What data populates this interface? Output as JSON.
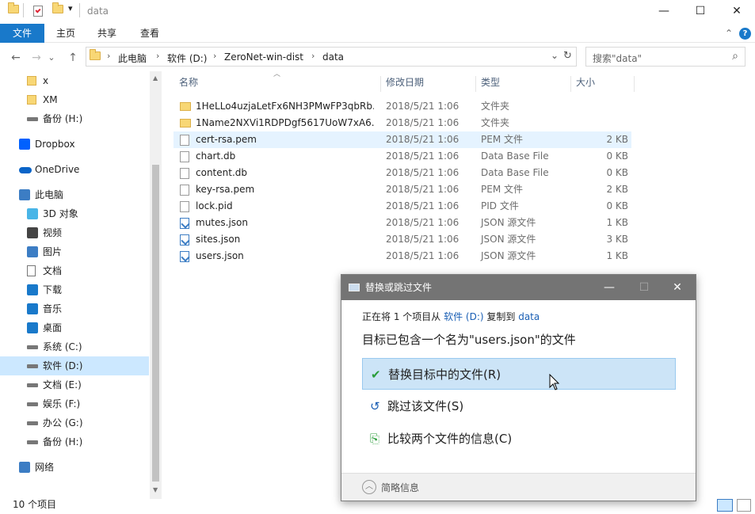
{
  "window": {
    "title": "data",
    "minimize": "—",
    "maximize": "☐",
    "close": "✕"
  },
  "ribbon": {
    "tabs": [
      {
        "label": "文件"
      },
      {
        "label": "主页"
      },
      {
        "label": "共享"
      },
      {
        "label": "查看"
      }
    ],
    "collapse": "⌃",
    "help": "?"
  },
  "address": {
    "back": "←",
    "forward": "→",
    "recent": "⌄",
    "up": "↑",
    "crumbs": [
      "此电脑",
      "软件 (D:)",
      "ZeroNet-win-dist",
      "data"
    ],
    "dropdown": "⌄",
    "refresh": "↻",
    "search_placeholder": "搜索\"data\"",
    "search_icon": "⌕"
  },
  "sidebar": {
    "items": [
      {
        "label": "x",
        "icon": "folder-icon"
      },
      {
        "label": "XM",
        "icon": "folder-icon"
      },
      {
        "label": "备份 (H:)",
        "icon": "drive-icon"
      },
      {
        "label": "Dropbox",
        "icon": "dropbox-icon"
      },
      {
        "label": "OneDrive",
        "icon": "onedrive-icon"
      },
      {
        "label": "此电脑",
        "icon": "computer-icon"
      },
      {
        "label": "3D 对象",
        "icon": "cube-icon"
      },
      {
        "label": "视频",
        "icon": "video-icon"
      },
      {
        "label": "图片",
        "icon": "picture-icon"
      },
      {
        "label": "文档",
        "icon": "document-icon"
      },
      {
        "label": "下载",
        "icon": "download-icon"
      },
      {
        "label": "音乐",
        "icon": "music-icon"
      },
      {
        "label": "桌面",
        "icon": "desktop-icon"
      },
      {
        "label": "系统 (C:)",
        "icon": "drive-icon"
      },
      {
        "label": "软件 (D:)",
        "icon": "drive-icon"
      },
      {
        "label": "文档 (E:)",
        "icon": "drive-icon"
      },
      {
        "label": "娱乐 (F:)",
        "icon": "drive-icon"
      },
      {
        "label": "办公 (G:)",
        "icon": "drive-icon"
      },
      {
        "label": "备份 (H:)",
        "icon": "drive-icon"
      },
      {
        "label": "网络",
        "icon": "network-icon"
      }
    ]
  },
  "columns": {
    "name": "名称",
    "date": "修改日期",
    "type": "类型",
    "size": "大小"
  },
  "files": [
    {
      "name": "1HeLLo4uzjaLetFx6NH3PMwFP3qbRb...",
      "date": "2018/5/21 1:06",
      "type": "文件夹",
      "size": "",
      "kind": "folder"
    },
    {
      "name": "1Name2NXVi1RDPDgf5617UoW7xA6...",
      "date": "2018/5/21 1:06",
      "type": "文件夹",
      "size": "",
      "kind": "folder"
    },
    {
      "name": "cert-rsa.pem",
      "date": "2018/5/21 1:06",
      "type": "PEM 文件",
      "size": "2 KB",
      "kind": "file"
    },
    {
      "name": "chart.db",
      "date": "2018/5/21 1:06",
      "type": "Data Base File",
      "size": "0 KB",
      "kind": "db"
    },
    {
      "name": "content.db",
      "date": "2018/5/21 1:06",
      "type": "Data Base File",
      "size": "0 KB",
      "kind": "db"
    },
    {
      "name": "key-rsa.pem",
      "date": "2018/5/21 1:06",
      "type": "PEM 文件",
      "size": "2 KB",
      "kind": "file"
    },
    {
      "name": "lock.pid",
      "date": "2018/5/21 1:06",
      "type": "PID 文件",
      "size": "0 KB",
      "kind": "file"
    },
    {
      "name": "mutes.json",
      "date": "2018/5/21 1:06",
      "type": "JSON 源文件",
      "size": "1 KB",
      "kind": "json"
    },
    {
      "name": "sites.json",
      "date": "2018/5/21 1:06",
      "type": "JSON 源文件",
      "size": "3 KB",
      "kind": "json"
    },
    {
      "name": "users.json",
      "date": "2018/5/21 1:06",
      "type": "JSON 源文件",
      "size": "1 KB",
      "kind": "json"
    }
  ],
  "status": {
    "count": "10 个项目"
  },
  "dialog": {
    "title": "替换或跳过文件",
    "line1_prefix": "正在将 1 个项目从 ",
    "source": "软件 (D:)",
    "line1_middle": " 复制到 ",
    "dest": "data",
    "heading": "目标已包含一个名为\"users.json\"的文件",
    "options": [
      {
        "label": "替换目标中的文件(R)",
        "icon": "✔"
      },
      {
        "label": "跳过该文件(S)",
        "icon": "↺"
      },
      {
        "label": "比较两个文件的信息(C)",
        "icon": "⎘"
      }
    ],
    "details": "简略信息",
    "minimize": "—",
    "maximize": "☐",
    "close": "✕"
  },
  "colors": {
    "accent": "#1979ca",
    "selected": "#cce8ff",
    "dialog_title": "#747474"
  }
}
